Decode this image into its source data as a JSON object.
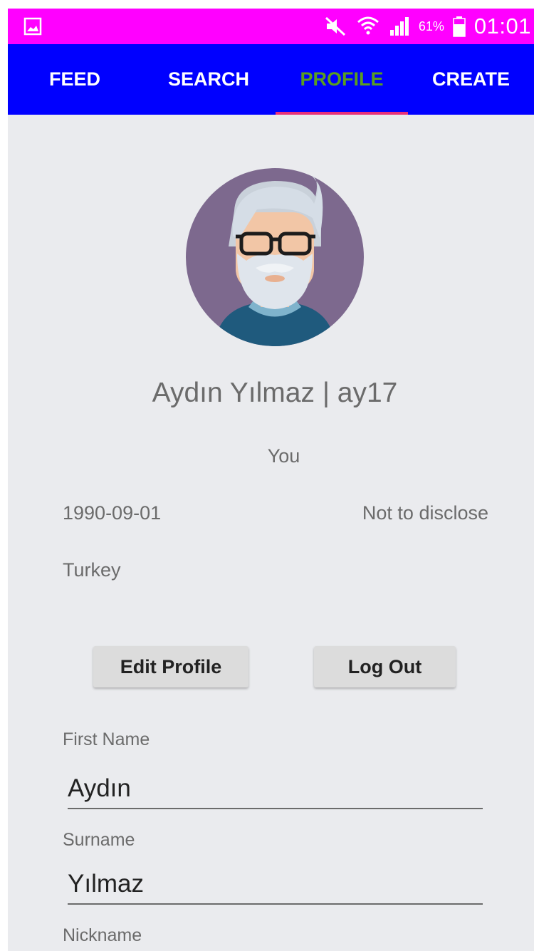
{
  "status_bar": {
    "battery_percent": "61%",
    "time": "01:01",
    "icons": [
      "image-icon",
      "mute-icon",
      "wifi-icon",
      "signal-icon",
      "battery-icon"
    ],
    "background": "#ff00ff"
  },
  "tabs": [
    {
      "label": "FEED",
      "active": false
    },
    {
      "label": "SEARCH",
      "active": false
    },
    {
      "label": "PROFILE",
      "active": true
    },
    {
      "label": "CREATE",
      "active": false
    }
  ],
  "colors": {
    "tab_bar": "#0000ff",
    "active_tab_text": "#5a9e1f",
    "tab_indicator": "#e8307a",
    "page_background": "#eaebee"
  },
  "profile": {
    "avatar_icon": "bearded-man-with-glasses-avatar",
    "display_name": "Aydın Yılmaz | ay17",
    "relation": "You",
    "birth_date": "1990-09-01",
    "gender": "Not to disclose",
    "country": "Turkey"
  },
  "buttons": {
    "edit_profile": "Edit Profile",
    "log_out": "Log Out"
  },
  "form": {
    "first_name_label": "First Name",
    "first_name_value": "Aydın",
    "surname_label": "Surname",
    "surname_value": "Yılmaz",
    "nickname_label": "Nickname"
  }
}
